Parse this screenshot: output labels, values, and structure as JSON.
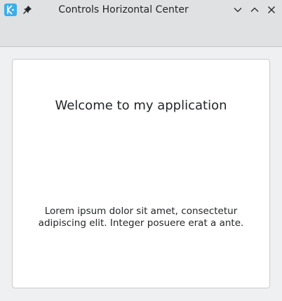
{
  "window": {
    "title": "Controls Horizontal Center",
    "app_icon": "kde-icon",
    "pin_icon": "pin-icon",
    "controls": [
      "minimize-icon",
      "maximize-icon",
      "close-icon"
    ]
  },
  "main": {
    "heading": "Welcome to my application",
    "body_text": "Lorem ipsum dolor sit amet, consectetur adipiscing elit. Integer posuere erat a ante."
  },
  "colors": {
    "accent": "#3daee9",
    "text": "#232629",
    "titlebar": "#dfe1e3",
    "card": "#ffffff"
  }
}
